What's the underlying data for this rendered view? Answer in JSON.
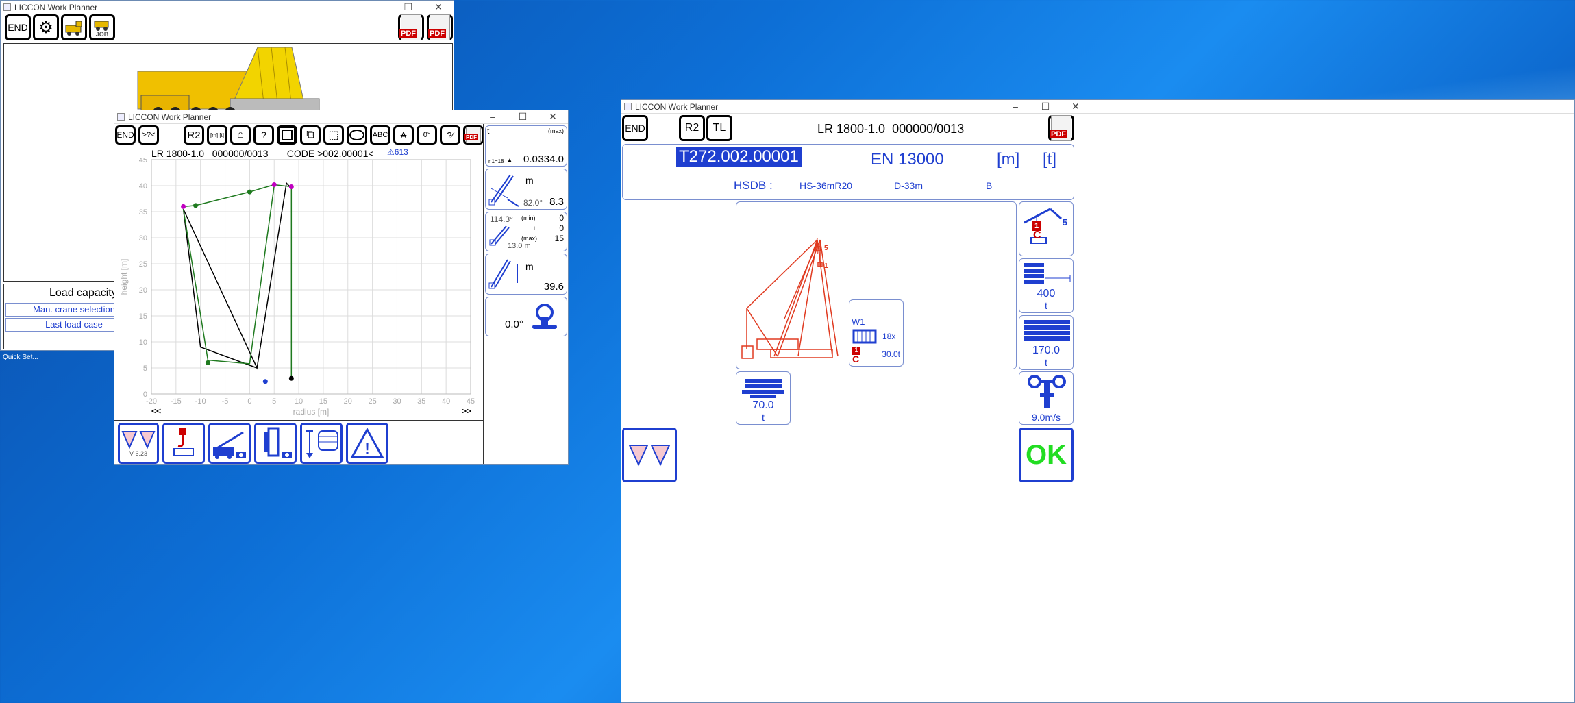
{
  "desktop": {
    "quickset_label": "Quick Set..."
  },
  "win1": {
    "title": "LICCON Work Planner",
    "end_label": "END",
    "job_label": "JOB",
    "pdf_label": "PDF",
    "load_capacity_title": "Load capacity",
    "man_crane_selection": "Man. crane selection",
    "last_load_case": "Last load case"
  },
  "win2": {
    "title": "LICCON Work Planner",
    "toolbar": {
      "end": "END",
      "help": ">?<",
      "r2": "R2",
      "units": "[m] [t]",
      "abc": "ABC",
      "pdf": "PDF"
    },
    "header": {
      "model": "LR 1800-1.0",
      "serial": "000000/0013",
      "code": "CODE >002.00001<",
      "warning_num": "613"
    },
    "nav_prev": "<<",
    "nav_next": ">>",
    "version": "V 6.23",
    "side": {
      "t_label": "t",
      "max_label": "(max)",
      "n_label": "n1=18",
      "load_val": "0.0",
      "max_val": "334.0",
      "m_label": "m",
      "angle": "82.0°",
      "radius_val": "8.3",
      "slew_angle": "114.3°",
      "min_label": "(min)",
      "min_val": "0",
      "t2": "t",
      "t2_val": "0",
      "max2": "(max)",
      "max2_val": "15",
      "dist": "13.0 m",
      "m2_label": "m",
      "height_val": "39.6",
      "slew_val": "0.0°"
    }
  },
  "chart_data": {
    "type": "line",
    "xlabel": "radius [m]",
    "ylabel": "height [m]",
    "xlim": [
      -20,
      45
    ],
    "ylim": [
      0,
      45
    ],
    "xticks": [
      -20,
      -15,
      -10,
      -5,
      0,
      5,
      10,
      15,
      20,
      25,
      30,
      35,
      40,
      45
    ],
    "yticks": [
      0,
      5,
      10,
      15,
      20,
      25,
      30,
      35,
      40,
      45
    ],
    "grid": true,
    "series": [
      {
        "color": "#000000",
        "values": [
          [
            -13.5,
            35.5
          ],
          [
            1.5,
            5
          ],
          [
            7.5,
            40.5
          ],
          [
            8.5,
            39.5
          ]
        ]
      },
      {
        "color": "#000000",
        "values": [
          [
            -13.5,
            35.5
          ],
          [
            -10,
            9
          ],
          [
            1.5,
            5
          ]
        ]
      },
      {
        "color": "#1f7a1f",
        "values": [
          [
            -13.5,
            36
          ],
          [
            -11,
            36.2
          ],
          [
            0,
            38.8
          ],
          [
            5,
            40.2
          ],
          [
            8.5,
            39.8
          ],
          [
            8.5,
            3
          ]
        ]
      },
      {
        "color": "#1f7a1f",
        "values": [
          [
            -13.5,
            35.5
          ],
          [
            -8.5,
            6.5
          ],
          [
            0,
            5.8
          ],
          [
            5,
            40
          ]
        ]
      }
    ],
    "markers": [
      {
        "x": -13.5,
        "y": 36,
        "color": "#c000c0"
      },
      {
        "x": -11,
        "y": 36.2,
        "color": "#1f7a1f"
      },
      {
        "x": 0,
        "y": 38.8,
        "color": "#1f7a1f"
      },
      {
        "x": 5,
        "y": 40.2,
        "color": "#c000c0"
      },
      {
        "x": 8.5,
        "y": 39.8,
        "color": "#c000c0"
      },
      {
        "x": 8.5,
        "y": 3,
        "color": "#000000"
      },
      {
        "x": -8.5,
        "y": 6,
        "color": "#1f7a1f"
      },
      {
        "x": 3.2,
        "y": 2.4,
        "color": "#1f3fd0"
      }
    ]
  },
  "win3": {
    "title": "LICCON Work Planner",
    "end": "END",
    "r2": "R2",
    "tl": "TL",
    "model": "LR 1800-1.0",
    "serial": "000000/0013",
    "code": "T272.002.00001",
    "standard": "EN 13000",
    "unit_m": "[m]",
    "unit_t": "[t]",
    "hsdb_label": "HSDB :",
    "hsdb1": "HS-36mR20",
    "hsdb2": "D-33m",
    "hsdb3": "B",
    "winch": {
      "name": "W1",
      "count": "18x",
      "load": "30.0t",
      "hook": "1"
    },
    "tip_label_5": "5",
    "tip_label_1": "1",
    "hook_badge": "1",
    "hook_count": "5",
    "ballast_val": "400",
    "ballast_unit": "t",
    "counterweight_val": "170.0",
    "counterweight_unit": "t",
    "central_ballast_val": "70.0",
    "central_ballast_unit": "t",
    "wind_val": "9.0m/s",
    "ok": "OK",
    "pdf": "PDF"
  }
}
